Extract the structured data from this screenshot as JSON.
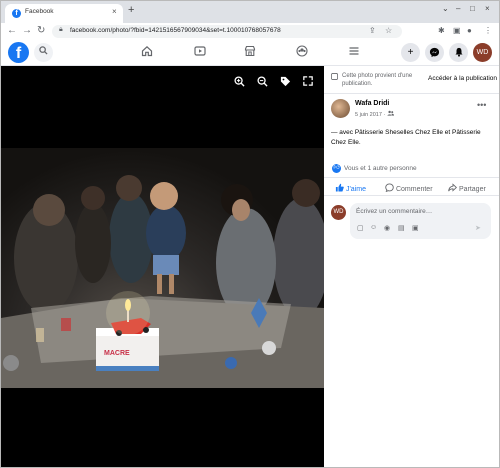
{
  "browser": {
    "tab_title": "Facebook",
    "tab_close": "×",
    "new_tab": "+",
    "url": "facebook.com/photo/?fbid=1421516567909034&set=t.100010768057678",
    "window_controls": [
      "⌄",
      "–",
      "□",
      "×"
    ]
  },
  "fb": {
    "logo": "f",
    "avatar_initials": "WD"
  },
  "panel": {
    "album_note": "Cette photo provient d'une publication.",
    "album_link": "Accéder à la publication",
    "author": "Wafa Dridi",
    "date": "5 juin 2017 ·",
    "caption": "— avec Pâtisserie Sheselles Chez Elle et Pâtisserie Chez Elle.",
    "reactions": "Vous et 1 autre personne",
    "like_label": "J'aime",
    "comment_label": "Commenter",
    "share_label": "Partager",
    "comment_placeholder": "Écrivez un commentaire…"
  },
  "photo": {
    "cake_text": "MACRE"
  },
  "colors": {
    "fb_blue": "#1877f2",
    "panel_bg": "#ffffff",
    "photo_bg": "#000000"
  },
  "icons": {
    "zoom_in": "zoom-in-icon",
    "zoom_out": "zoom-out-icon",
    "tag": "tag-icon",
    "fullscreen": "fullscreen-icon"
  }
}
